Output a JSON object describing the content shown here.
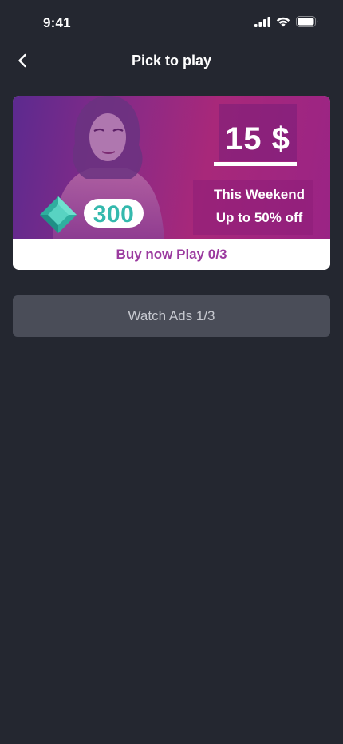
{
  "status_bar": {
    "time": "9:41",
    "icons": [
      "cellular-signal-icon",
      "wifi-icon",
      "battery-icon"
    ]
  },
  "nav": {
    "title": "Pick to play",
    "back_icon": "chevron-left-icon"
  },
  "promo": {
    "price": "15 $",
    "offer_line_1": "This Weekend",
    "offer_line_2": "Up to 50% off",
    "gem_icon": "diamond-gem-icon",
    "gem_count": "300",
    "cta": "Buy now Play 0/3",
    "colors": {
      "banner": "#8a2a86",
      "gem": "#34b9ad",
      "cta_text": "#9b3a9f"
    }
  },
  "watch_ads": {
    "label": "Watch Ads 1/3"
  },
  "colors": {
    "background": "#242730",
    "secondary_button": "#4a4d58"
  }
}
